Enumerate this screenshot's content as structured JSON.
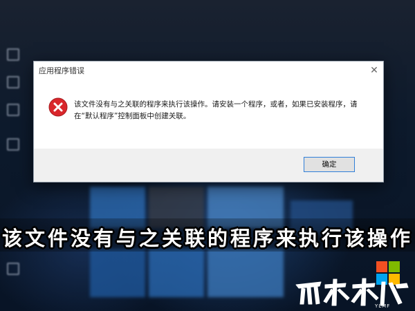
{
  "dialog": {
    "title": "应用程序错误",
    "close_glyph": "✕",
    "message": "该文件没有与之关联的程序来执行该操作。请安装一个程序，或者，如果已安装程序，请在“默认程序”控制面板中创建关联。",
    "ok_label": "确定",
    "icon": "error-icon"
  },
  "caption": "该文件没有与之关联的程序来执行该操作",
  "watermark": {
    "text": "雨林木风",
    "sub": "YLMF"
  },
  "colors": {
    "error_red": "#d9262b",
    "button_border": "#2f7ed8",
    "footer_bg": "#f0f0f0",
    "ms_red": "#f25022",
    "ms_green": "#7fba00",
    "ms_blue": "#00a4ef",
    "ms_yellow": "#ffb900"
  }
}
